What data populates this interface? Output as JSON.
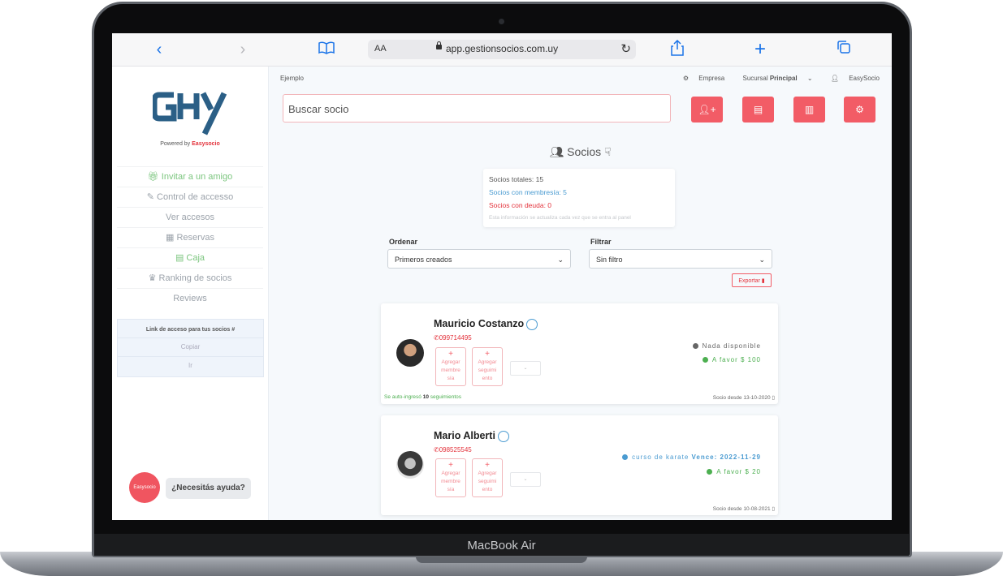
{
  "device": {
    "label": "MacBook Air"
  },
  "browser": {
    "aa_label": "AA",
    "url": "app.gestionsocios.com.uy",
    "icons": [
      "back-icon",
      "forward-icon",
      "bookmarks-icon",
      "lock-icon",
      "reload-icon",
      "share-icon",
      "new-tab-icon",
      "tabs-icon"
    ]
  },
  "sidebar": {
    "logo_text": "GHY",
    "powered_prefix": "Powered by",
    "powered_brand": "Easysocio",
    "items": [
      {
        "label": "Invitar a un amigo",
        "icon": "gift-icon",
        "color": "#7cc67f"
      },
      {
        "label": "Control de accesso",
        "icon": "edit-icon"
      },
      {
        "label": "Ver accesos"
      },
      {
        "label": "Reservas",
        "icon": "calendar-icon"
      },
      {
        "label": "Caja",
        "icon": "cash-register-icon",
        "color": "#7cc67f"
      },
      {
        "label": "Ranking de socios",
        "icon": "trophy-icon"
      },
      {
        "label": "Reviews"
      }
    ],
    "link_box": {
      "title": "Link de acceso para tus socios",
      "copy": "Copiar",
      "go": "Ir"
    },
    "help": {
      "avatar_text": "Easysocio",
      "button": "¿Necesitás ayuda?"
    }
  },
  "header": {
    "breadcrumb": "Ejemplo",
    "company": "Empresa",
    "branch_prefix": "Sucursal",
    "branch": "Principal",
    "user": "EasySocio"
  },
  "search": {
    "placeholder": "Buscar socio"
  },
  "toolbar": {
    "buttons": [
      "add-user-icon",
      "cash-register-icon",
      "chart-icon",
      "gear-icon"
    ],
    "color": "#f25c66"
  },
  "members_title": "Socios",
  "stats": {
    "total": "Socios totales: 15",
    "with_membership": "Socios con membresía: 5",
    "with_debt": "Socios con deuda: 0",
    "note": "Esta información se actualiza cada vez que se entra al panel"
  },
  "filters": {
    "order_label": "Ordenar",
    "order_value": "Primeros creados",
    "filter_label": "Filtrar",
    "filter_value": "Sin filtro",
    "export": "Exportar"
  },
  "cards": [
    {
      "name": "Mauricio Costanzo",
      "phone": "099714495",
      "action1": [
        "Agregar",
        "membre",
        "sía"
      ],
      "action2": [
        "Agregar",
        "seguimi",
        "ento"
      ],
      "status1": "Nada disponible",
      "status2": "A favor $ 100",
      "footer_prefix": "Se auto-ingresó",
      "footer_count": "10",
      "footer_suffix": "seguimientos",
      "since": "Socio desde 13-10-2020"
    },
    {
      "name": "Mario Alberti",
      "phone": "098525545",
      "action1": [
        "Agregar",
        "membre",
        "sía"
      ],
      "action2": [
        "Agregar",
        "seguimi",
        "ento"
      ],
      "status1_prefix": "curso de karate",
      "status1_due": "Vence: 2022-11-29",
      "status2": "A favor $ 20",
      "since": "Socio desde 10-08-2021"
    }
  ]
}
